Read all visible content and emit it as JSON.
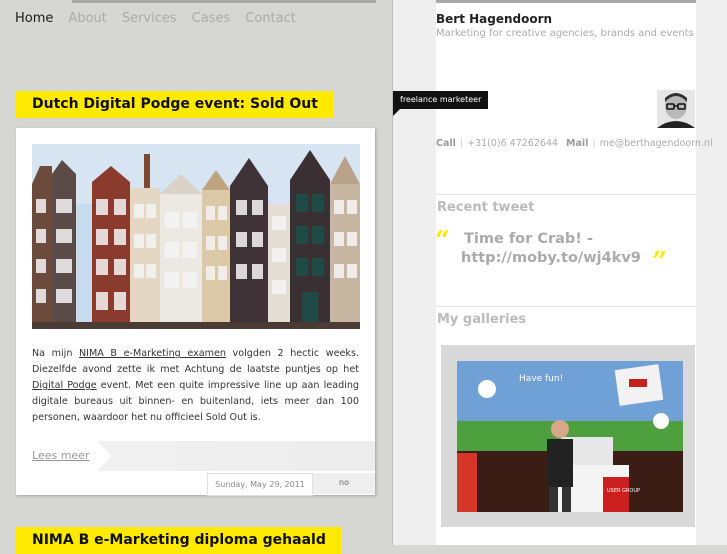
{
  "nav": {
    "items": [
      "Home",
      "About",
      "Services",
      "Cases",
      "Contact"
    ]
  },
  "posts": [
    {
      "title": "Dutch Digital Podge event: Sold Out",
      "body_parts": {
        "p1": "Na mijn ",
        "link1": "NIMA B e-Marketing examen",
        "p2": " volgden 2 hectic weeks. Diezelfde avond zette ik met Achtung de laatste puntjes op het ",
        "link2": "Digital Podge",
        "p3": " event. Met een quite impressive line up aan leading digitale bureaus uit binnen- en buitenland, iets meer dan 100 personen, waardoor het nu officieel Sold Out is."
      },
      "read_more": "Lees meer",
      "date": "Sunday, May 29, 2011",
      "comments": "no"
    },
    {
      "title": "NIMA B e-Marketing diploma gehaald"
    }
  ],
  "sidebar": {
    "name": "Bert Hagendoorn",
    "tagline": "Marketing for creative agencies, brands and events",
    "badge": "freelance marketeer",
    "contact": {
      "call_label": "Call",
      "phone": "+31(0)6 47262644",
      "mail_label": "Mail",
      "email": "me@berthagendoorn.nl"
    },
    "recent_tweet_heading": "Recent tweet",
    "tweet_line1": "Time for Crab! -",
    "tweet_line2": "http://moby.to/wj4kv9",
    "galleries_heading": "My galleries",
    "gallery_screen_text": "Have fun!",
    "gallery_banner_text": "USER GROUP"
  },
  "colors": {
    "accent_yellow": "#ffea00",
    "left_background": "#d6d6d3"
  }
}
